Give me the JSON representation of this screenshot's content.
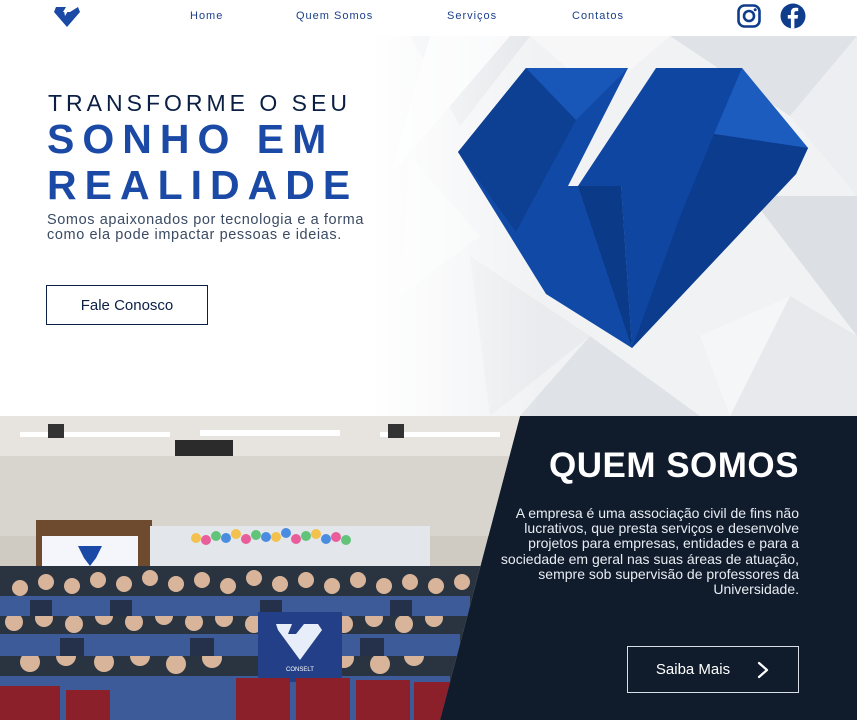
{
  "nav": {
    "logo": "diamond-logo",
    "items": [
      {
        "label": "Home"
      },
      {
        "label": "Quem Somos"
      },
      {
        "label": "Serviços"
      },
      {
        "label": "Contatos"
      }
    ],
    "social": [
      "instagram-icon",
      "facebook-icon"
    ]
  },
  "hero": {
    "kicker": "TRANSFORME O SEU",
    "title_line1": "SONHO EM",
    "title_line2": "REALIDADE",
    "subtitle": "Somos apaixonados por tecnologia e a forma como ela pode impactar pessoas e ideias.",
    "cta_label": "Fale Conosco"
  },
  "about": {
    "title": "QUEM SOMOS",
    "text": "A empresa é uma associação civil de fins não lucrativos, que presta serviços e desenvolve projetos para empresas, entidades e para a sociedade em geral nas suas áreas de atuação, sempre sob supervisão de professores da Universidade.",
    "cta_label": "Saiba Mais",
    "banner_text": "CONSELT"
  },
  "colors": {
    "brand_blue": "#1a4aa5",
    "dark_blue": "#0b1f44",
    "panel": "#101c2c"
  }
}
